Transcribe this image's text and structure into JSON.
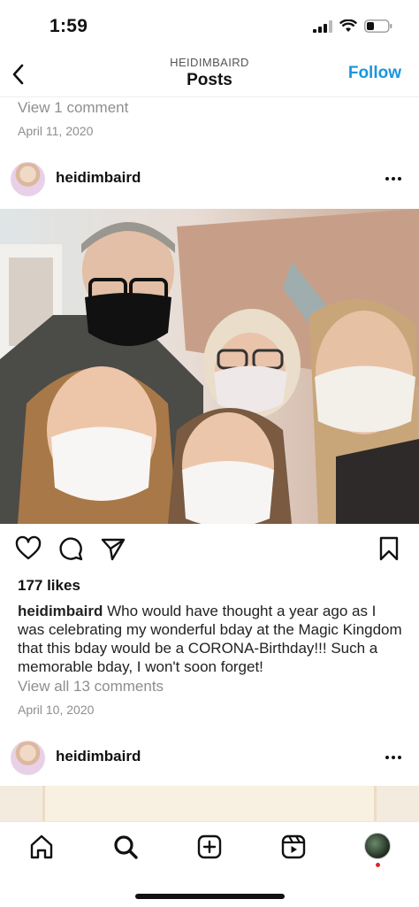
{
  "status_bar": {
    "time": "1:59"
  },
  "nav": {
    "subtitle": "HEIDIMBAIRD",
    "title": "Posts",
    "follow_label": "Follow"
  },
  "previous_post": {
    "view_comments": "View 1 comment",
    "date": "April 11, 2020"
  },
  "post": {
    "username": "heidimbaird",
    "likes": "177 likes",
    "caption_user": "heidimbaird",
    "caption_text": "Who would have thought a year ago as I was celebrating my wonderful bday at the Magic Kingdom that this bday would be a CORONA-Birthday!!! Such a memorable bday, I won't soon forget!",
    "view_all_comments": "View all 13 comments",
    "date": "April 10, 2020",
    "image_alt": "Group selfie of five people wearing face masks"
  },
  "next_post": {
    "username": "heidimbaird"
  },
  "tab_bar": {
    "items": [
      "home-icon",
      "search-icon",
      "create-icon",
      "reels-icon",
      "profile-avatar"
    ]
  },
  "colors": {
    "accent": "#1a96e0",
    "muted": "#8e8e8e",
    "notification": "#e2262b"
  }
}
